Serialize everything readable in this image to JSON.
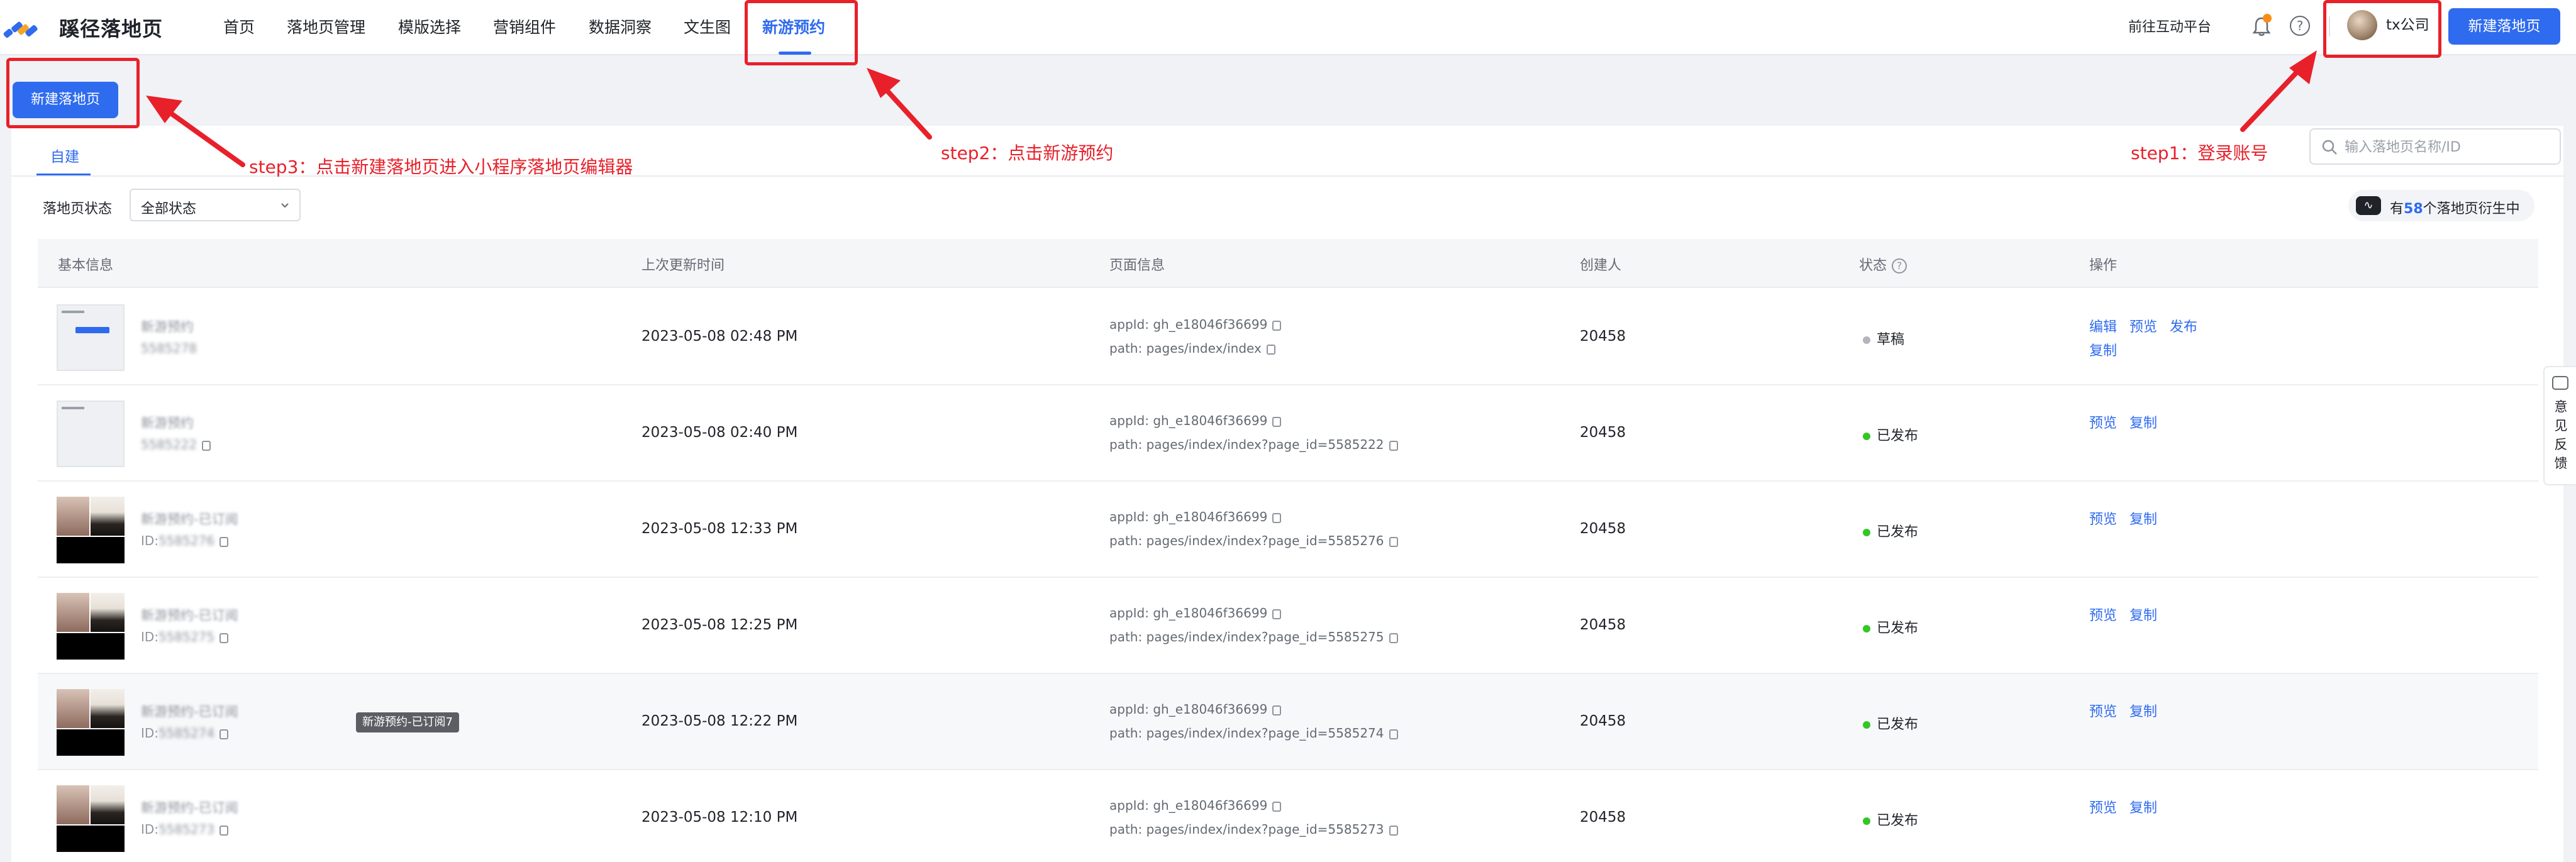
{
  "app": {
    "logo_text": "蹊径落地页"
  },
  "nav": {
    "items": [
      "首页",
      "落地页管理",
      "模版选择",
      "营销组件",
      "数据洞察",
      "文生图",
      "新游预约"
    ],
    "active": "新游预约",
    "interactive_platform_link": "前往互动平台",
    "help_glyph": "?",
    "account_name": "tx公司",
    "create_button": "新建落地页"
  },
  "toolbar": {
    "create_button": "新建落地页"
  },
  "tabs": {
    "self_built": "自建"
  },
  "search": {
    "placeholder": "输入落地页名称/ID"
  },
  "filter": {
    "label": "落地页状态",
    "selected": "全部状态"
  },
  "derive": {
    "prefix": "有",
    "count": "58",
    "suffix": "个落地页衍生中"
  },
  "table": {
    "headers": {
      "basic_info": "基本信息",
      "updated": "上次更新时间",
      "page_info": "页面信息",
      "creator": "创建人",
      "status": "状态",
      "ops": "操作"
    },
    "rows": [
      {
        "name": "新游预约",
        "id_prefix": "",
        "id_value": "5585278",
        "updated": "2023-05-08 02:48 PM",
        "appid": "appId: gh_e18046f36699",
        "path": "path: pages/index/index",
        "creator": "20458",
        "status": "草稿",
        "status_color": "#b2b5bb",
        "ops": [
          "编辑",
          "预览",
          "发布",
          "复制"
        ]
      },
      {
        "name": "新游预约",
        "id_prefix": "",
        "id_value": "5585222",
        "updated": "2023-05-08 02:40 PM",
        "appid": "appId: gh_e18046f36699",
        "path": "path: pages/index/index?page_id=5585222",
        "creator": "20458",
        "status": "已发布",
        "status_color": "#34c724",
        "ops": [
          "预览",
          "复制"
        ]
      },
      {
        "name": "新游预约-已订阅",
        "id_prefix": "ID:",
        "id_value": "5585276",
        "updated": "2023-05-08 12:33 PM",
        "appid": "appId: gh_e18046f36699",
        "path": "path: pages/index/index?page_id=5585276",
        "creator": "20458",
        "status": "已发布",
        "status_color": "#34c724",
        "ops": [
          "预览",
          "复制"
        ]
      },
      {
        "name": "新游预约-已订阅",
        "id_prefix": "ID:",
        "id_value": "5585275",
        "updated": "2023-05-08 12:25 PM",
        "appid": "appId: gh_e18046f36699",
        "path": "path: pages/index/index?page_id=5585275",
        "creator": "20458",
        "status": "已发布",
        "status_color": "#34c724",
        "ops": [
          "预览",
          "复制"
        ]
      },
      {
        "name": "新游预约-已订阅",
        "id_prefix": "ID:",
        "id_value": "5585274",
        "updated": "2023-05-08 12:22 PM",
        "appid": "appId: gh_e18046f36699",
        "path": "path: pages/index/index?page_id=5585274",
        "creator": "20458",
        "status": "已发布",
        "status_color": "#34c724",
        "ops": [
          "预览",
          "复制"
        ]
      },
      {
        "name": "新游预约-已订阅",
        "id_prefix": "ID:",
        "id_value": "5585273",
        "updated": "2023-05-08 12:10 PM",
        "appid": "appId: gh_e18046f36699",
        "path": "path: pages/index/index?page_id=5585273",
        "creator": "20458",
        "status": "已发布",
        "status_color": "#34c724",
        "ops": [
          "预览",
          "复制"
        ]
      }
    ]
  },
  "tooltip": "新游预约-已订阅7",
  "feedback": {
    "label": "意见反馈"
  },
  "annotations": {
    "step1": "step1：登录账号",
    "step2": "step2：点击新游预约",
    "step3": "step3：点击新建落地页进入小程序落地页编辑器",
    "color": "#e8202a"
  },
  "colors": {
    "primary": "#2f6bef",
    "published": "#34c724",
    "draft": "#b2b5bb"
  }
}
